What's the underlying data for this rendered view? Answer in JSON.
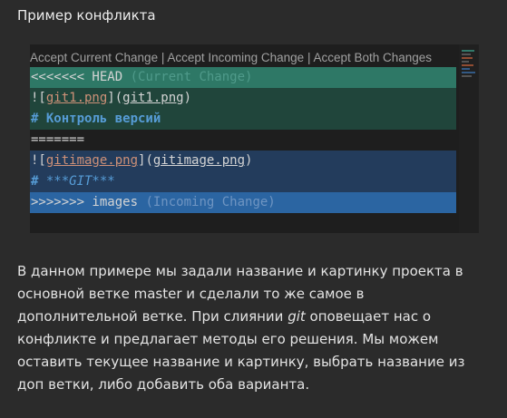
{
  "page": {
    "heading": "Пример конфликта"
  },
  "codelens": {
    "accept_current": "Accept Current Change",
    "separator": " | ",
    "accept_incoming": "Accept Incoming Change",
    "accept_both": "Accept Both Changes"
  },
  "code": {
    "head_marker": "<<<<<<< HEAD",
    "head_label": " (Current Change)",
    "line2_bang": "![",
    "line2_alt": "git1.png",
    "line2_mid": "](",
    "line2_url": "git1.png",
    "line2_end": ")",
    "line3": "# Контроль версий",
    "separator": "=======",
    "line5_bang": "![",
    "line5_alt": "gitimage.png",
    "line5_mid": "](",
    "line5_url": "gitimage.png",
    "line5_end": ")",
    "line6_hash": "# ",
    "line6_text": "***GIT***",
    "incoming_marker": ">>>>>>> images",
    "incoming_label": " (Incoming Change)"
  },
  "paragraph": {
    "part1": "В данном примере мы задали название и картинку проекта в основной ветке master и сделали то же самое в дополнительной ветке. При слиянии ",
    "git": "git",
    "part2": " оповещает нас о конфликте и предлагает методы его решения. Мы можем оставить текущее название и картинку, выбрать название из доп ветки, либо добавить оба варианта."
  },
  "colors": {
    "current_header": "#2e7866",
    "current_body": "#20453b",
    "incoming_body": "#233c5c",
    "incoming_header": "#2b65a2"
  }
}
